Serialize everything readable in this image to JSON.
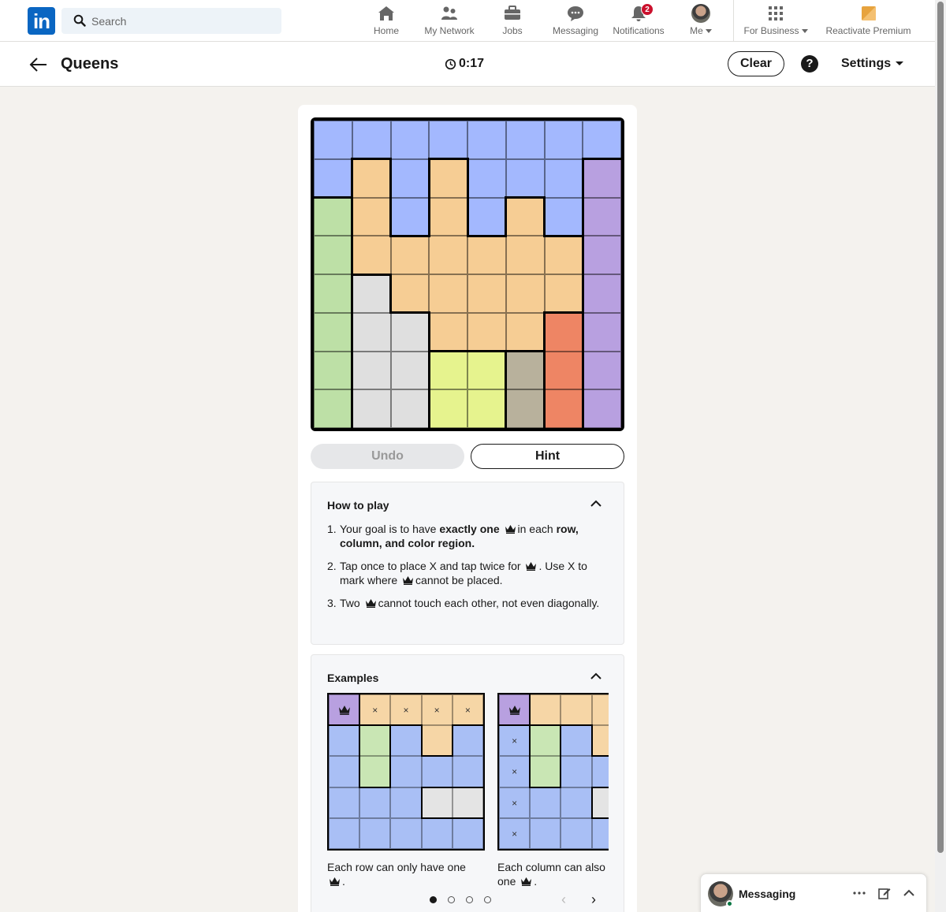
{
  "nav": {
    "logo": "in",
    "search_placeholder": "Search",
    "items": [
      {
        "label": "Home",
        "icon": "home-icon"
      },
      {
        "label": "My Network",
        "icon": "network-icon"
      },
      {
        "label": "Jobs",
        "icon": "briefcase-icon"
      },
      {
        "label": "Messaging",
        "icon": "messaging-icon"
      },
      {
        "label": "Notifications",
        "icon": "bell-icon",
        "badge": "2"
      },
      {
        "label": "Me",
        "icon": "avatar"
      },
      {
        "label": "For Business",
        "icon": "grid-icon"
      },
      {
        "label": "Reactivate Premium",
        "icon": "premium-icon"
      }
    ]
  },
  "game": {
    "title": "Queens",
    "timer": "0:17",
    "clear_label": "Clear",
    "help_label": "?",
    "settings_label": "Settings",
    "undo_label": "Undo",
    "hint_label": "Hint",
    "region_colors": {
      "B": "#a3b8fe",
      "O": "#f6cd94",
      "P": "#b8a0e0",
      "G": "#bde0a6",
      "W": "#dfdfdf",
      "Y": "#e6f38e",
      "T": "#b8b19c",
      "R": "#ee8564"
    },
    "board": [
      "BBBBBBBB",
      "BOBOBBBP",
      "GOBOBOBP",
      "GOOOOOOP",
      "GWOOOOOP",
      "GWWOOORP",
      "GWWYYTRP",
      "GWWYYTRP"
    ]
  },
  "how_to_play": {
    "title": "How to play",
    "rules": [
      {
        "num": "1.",
        "parts": [
          "Your goal is to have ",
          "exactly one",
          " ",
          "in each ",
          "row, column, and color region."
        ]
      },
      {
        "num": "2.",
        "parts": [
          "Tap once to place X and tap twice for ",
          ". Use X to mark where ",
          "cannot be placed."
        ]
      },
      {
        "num": "3.",
        "parts": [
          "Two ",
          "cannot touch each other, not even diagonally."
        ]
      }
    ]
  },
  "examples": {
    "title": "Examples",
    "items": [
      {
        "caption": "Each row can only have one",
        "grid": [
          "POOOO",
          "BGBOB",
          "BGBBB",
          "BBBWW",
          "BBBBB"
        ],
        "marks": [
          "Q",
          "X",
          "X",
          "X",
          "X",
          "",
          "",
          "",
          "",
          "",
          "",
          "",
          "",
          "",
          "",
          "",
          "",
          "",
          "",
          "",
          "",
          "",
          "",
          "",
          ""
        ]
      },
      {
        "caption": "Each column can also have one",
        "grid": [
          "POOOO",
          "BGBOB",
          "BGBBB",
          "BBBWW",
          "BBBBB"
        ],
        "marks": [
          "Q",
          "",
          "",
          "",
          "",
          "X",
          "",
          "",
          "",
          "",
          "X",
          "",
          "",
          "",
          "",
          "X",
          "",
          "",
          "",
          "",
          "X",
          "",
          "",
          "",
          ""
        ]
      }
    ],
    "pager": {
      "count": 4,
      "active": 0,
      "prev": "‹",
      "next": "›"
    }
  },
  "messaging": {
    "label": "Messaging"
  }
}
